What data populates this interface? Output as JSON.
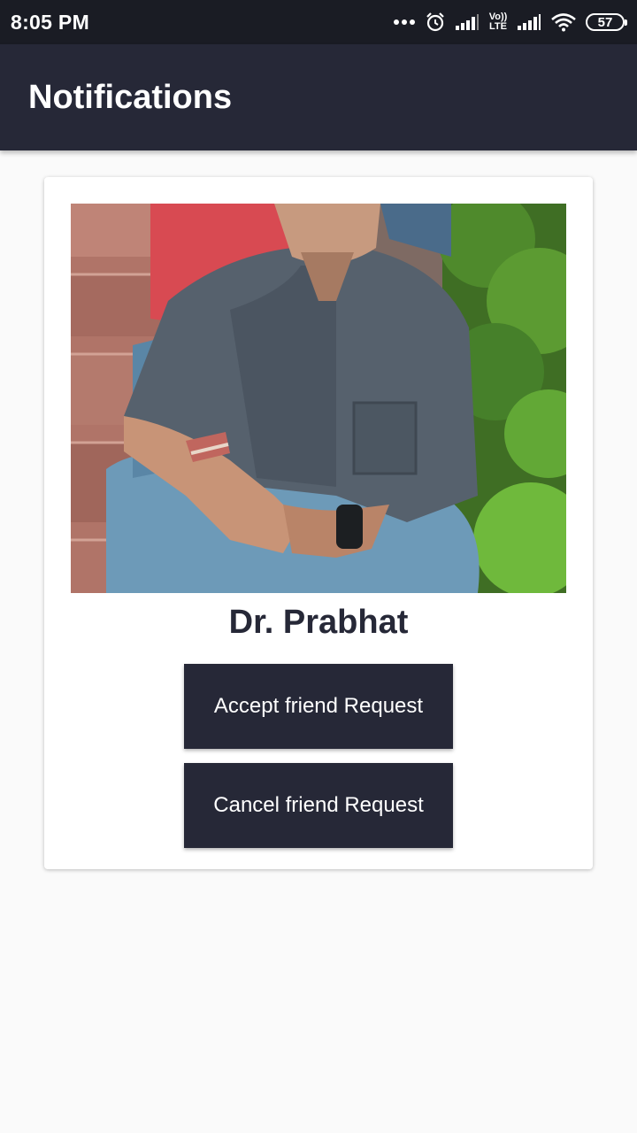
{
  "status_bar": {
    "time": "8:05 PM",
    "network_label": "Vo)) LTE",
    "battery_level": "57",
    "icons": [
      "more-dots-icon",
      "alarm-icon",
      "signal-icon",
      "lte-icon",
      "signal-icon",
      "wifi-icon",
      "battery-icon"
    ]
  },
  "app_bar": {
    "title": "Notifications"
  },
  "request_card": {
    "name": "Dr. Prabhat",
    "accept_label": "Accept friend Request",
    "cancel_label": "Cancel friend Request"
  },
  "colors": {
    "primary": "#262837",
    "status_bar": "#1a1c24",
    "background": "#fafafa",
    "card": "#ffffff"
  }
}
